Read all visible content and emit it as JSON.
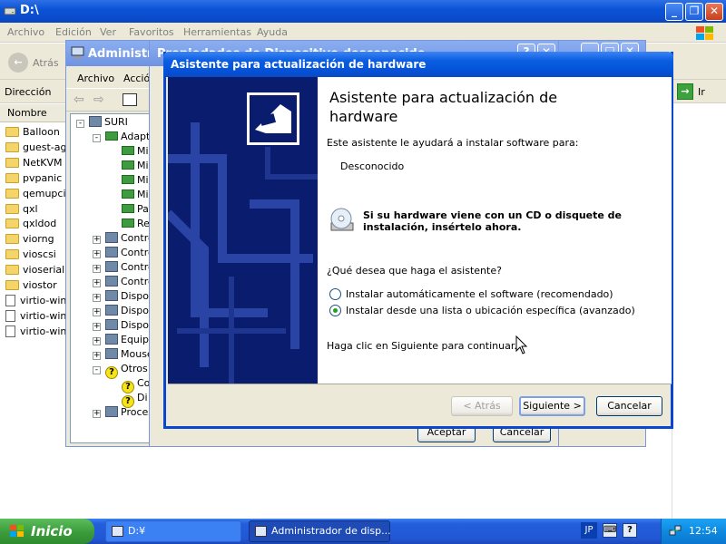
{
  "explorer": {
    "title": "D:\\",
    "menu": [
      "Archivo",
      "Edición",
      "Ver",
      "Favoritos",
      "Herramientas",
      "Ayuda"
    ],
    "back_label": "Atrás",
    "address_label": "Dirección",
    "go_label": "Ir",
    "column_name": "Nombre",
    "files": [
      {
        "name": "Balloon",
        "type": "folder"
      },
      {
        "name": "guest-age",
        "type": "folder"
      },
      {
        "name": "NetKVM",
        "type": "folder"
      },
      {
        "name": "pvpanic",
        "type": "folder"
      },
      {
        "name": "qemupcise",
        "type": "folder"
      },
      {
        "name": "qxl",
        "type": "folder"
      },
      {
        "name": "qxldod",
        "type": "folder"
      },
      {
        "name": "viorng",
        "type": "folder"
      },
      {
        "name": "vioscsi",
        "type": "folder"
      },
      {
        "name": "vioserial",
        "type": "folder"
      },
      {
        "name": "viostor",
        "type": "folder"
      },
      {
        "name": "virtio-win-",
        "type": "file"
      },
      {
        "name": "virtio-win-",
        "type": "file"
      },
      {
        "name": "virtio-win_",
        "type": "file"
      }
    ]
  },
  "device_manager": {
    "title": "Administra",
    "menu": [
      "Archivo",
      "Acción"
    ],
    "tree": [
      {
        "label": "SURI",
        "level": 0,
        "expander": "-",
        "icon": "computer-icon"
      },
      {
        "label": "Adapt",
        "level": 1,
        "expander": "-",
        "icon": "network-card-icon"
      },
      {
        "label": "Mi",
        "level": 2,
        "expander": "",
        "icon": "network-card-icon"
      },
      {
        "label": "Mi",
        "level": 2,
        "expander": "",
        "icon": "network-card-icon"
      },
      {
        "label": "Mi",
        "level": 2,
        "expander": "",
        "icon": "network-card-icon"
      },
      {
        "label": "Mi",
        "level": 2,
        "expander": "",
        "icon": "network-card-icon"
      },
      {
        "label": "Pa",
        "level": 2,
        "expander": "",
        "icon": "network-card-icon"
      },
      {
        "label": "Re",
        "level": 2,
        "expander": "",
        "icon": "network-card-icon"
      },
      {
        "label": "Contro",
        "level": 1,
        "expander": "+",
        "icon": "usb-icon"
      },
      {
        "label": "Contro",
        "level": 1,
        "expander": "+",
        "icon": "controller-icon"
      },
      {
        "label": "Contro",
        "level": 1,
        "expander": "+",
        "icon": "controller-icon"
      },
      {
        "label": "Contro",
        "level": 1,
        "expander": "+",
        "icon": "controller-icon"
      },
      {
        "label": "Dispos",
        "level": 1,
        "expander": "+",
        "icon": "device-icon"
      },
      {
        "label": "Dispos",
        "level": 1,
        "expander": "+",
        "icon": "device-icon"
      },
      {
        "label": "Dispos",
        "level": 1,
        "expander": "+",
        "icon": "device-icon"
      },
      {
        "label": "Equipo",
        "level": 1,
        "expander": "+",
        "icon": "computer-icon"
      },
      {
        "label": "Mouse",
        "level": 1,
        "expander": "+",
        "icon": "mouse-icon"
      },
      {
        "label": "Otros",
        "level": 1,
        "expander": "-",
        "icon": "warning-icon"
      },
      {
        "label": "Co",
        "level": 2,
        "expander": "",
        "icon": "warning-icon"
      },
      {
        "label": "Di",
        "level": 2,
        "expander": "",
        "icon": "warning-icon"
      },
      {
        "label": "Proces",
        "level": 1,
        "expander": "+",
        "icon": "processor-icon"
      }
    ]
  },
  "properties_dialog": {
    "title": "Propiedades de Dispositivo desconocido",
    "accept_label": "Aceptar",
    "cancel_label": "Cancelar"
  },
  "wizard": {
    "title": "Asistente para actualización de hardware",
    "heading": "Asistente para actualización de hardware",
    "intro": "Este asistente le ayudará a instalar software para:",
    "device_name": "Desconocido",
    "cd_notice": "Si su hardware viene con un CD o disquete de instalación, insértelo ahora.",
    "question": "¿Qué desea que haga el asistente?",
    "options": [
      {
        "label": "Instalar automáticamente el software (recomendado)",
        "selected": false
      },
      {
        "label": "Instalar desde una lista o ubicación específica (avanzado)",
        "selected": true
      }
    ],
    "continue_text": "Haga clic en Siguiente para continuar.",
    "back_button": "< Atrás",
    "next_button": "Siguiente >",
    "cancel_button": "Cancelar"
  },
  "taskbar": {
    "start_label": "Inicio",
    "buttons": [
      {
        "label": "D:¥",
        "active": false
      },
      {
        "label": "Administrador de disp...",
        "active": true
      }
    ],
    "language": "JP",
    "clock": "12:54"
  },
  "colors": {
    "title_active": "#0a54d6",
    "title_inactive": "#7a96df",
    "wizard_panel": "#0a1c6e",
    "taskbar": "#245edb",
    "start_button": "#3c9e3c",
    "tray": "#0e8ae0",
    "window_face": "#ece9d8"
  }
}
